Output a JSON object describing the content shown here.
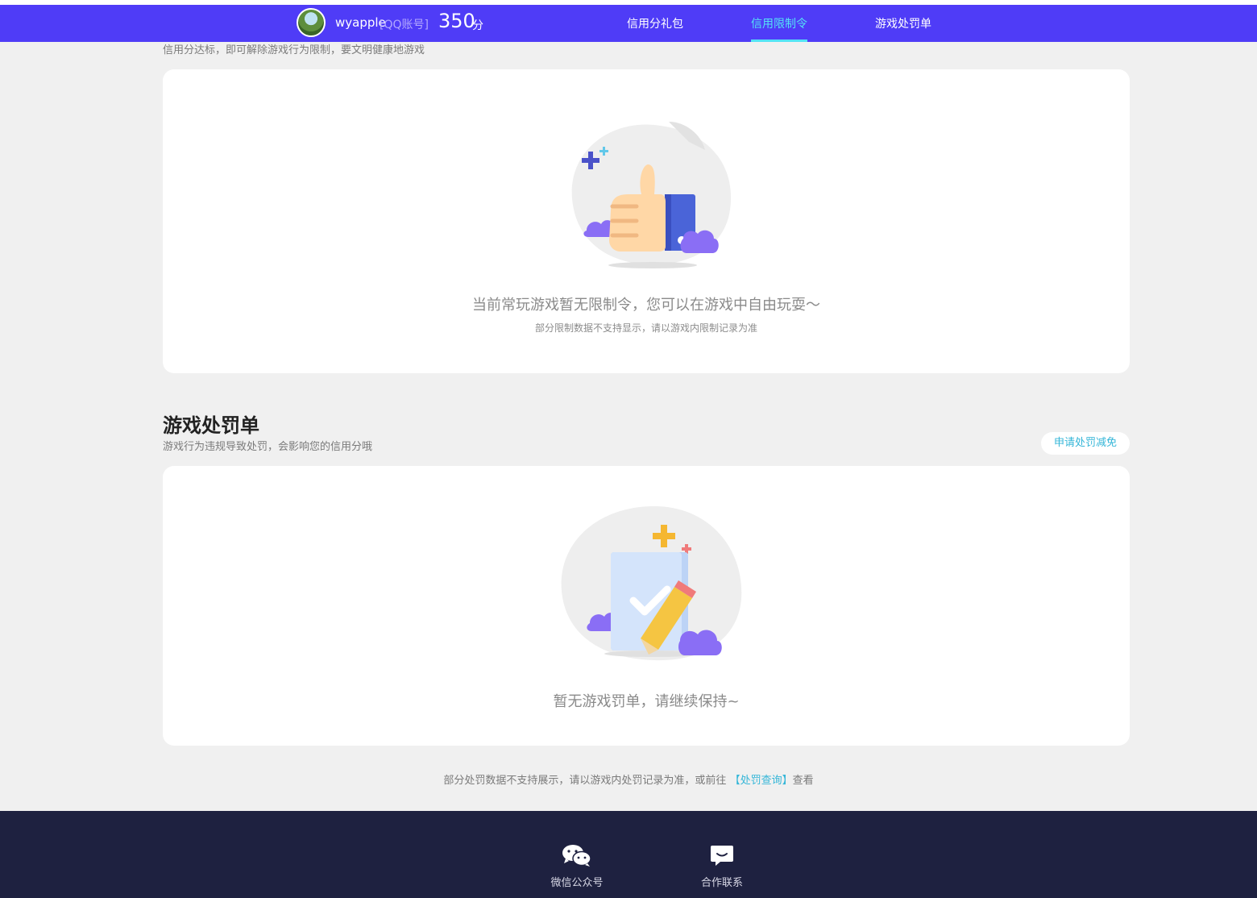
{
  "header": {
    "username": "wyapple",
    "account_type": "[QQ账号]",
    "score": "350",
    "score_unit": "分",
    "nav": [
      {
        "label": "信用分礼包",
        "active": false
      },
      {
        "label": "信用限制令",
        "active": true
      },
      {
        "label": "游戏处罚单",
        "active": false
      }
    ]
  },
  "restriction": {
    "description": "信用分达标，即可解除游戏行为限制，要文明健康地游戏",
    "empty_title": "当前常玩游戏暂无限制令，您可以在游戏中自由玩耍～",
    "empty_note": "部分限制数据不支持显示，请以游戏内限制记录为准"
  },
  "penalty": {
    "title": "游戏处罚单",
    "description": "游戏行为违规导致处罚，会影响您的信用分哦",
    "apply_button": "申请处罚减免",
    "empty_title": "暂无游戏罚单，请继续保持~",
    "footnote_prefix": "部分处罚数据不支持展示，请以游戏内处罚记录为准，或前往",
    "footnote_link": "【处罚查询】",
    "footnote_suffix": "查看"
  },
  "footer": {
    "items": [
      {
        "label": "微信公众号",
        "icon": "wechat-icon"
      },
      {
        "label": "合作联系",
        "icon": "chat-icon"
      }
    ]
  },
  "colors": {
    "header_bg": "#4f3cf7",
    "accent_cyan": "#54e3f5",
    "link_blue": "#34b6d8",
    "footer_bg": "#1e2140"
  }
}
